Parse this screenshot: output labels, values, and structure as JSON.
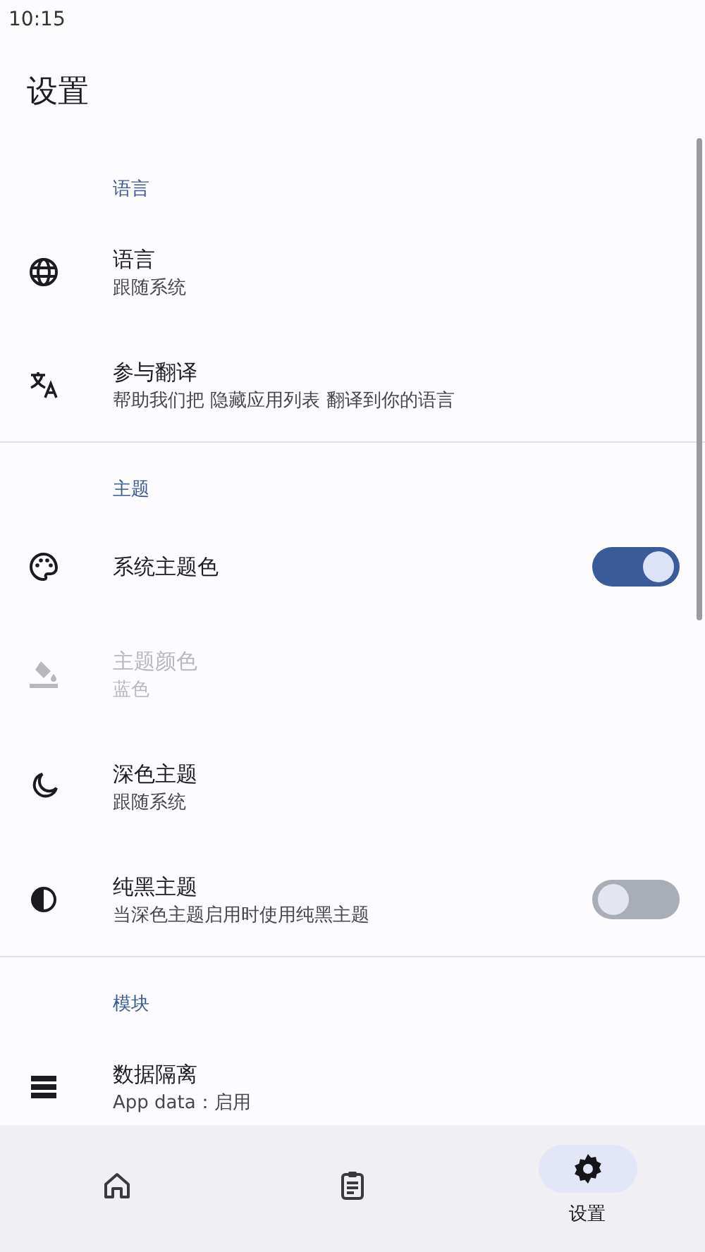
{
  "status_bar": {
    "time": "10:15"
  },
  "title": "设置",
  "sections": [
    {
      "header": "语言",
      "items": [
        {
          "kind": "plain",
          "title": "语言",
          "subtitle": "跟随系统",
          "disabled": false
        },
        {
          "kind": "plain",
          "title": "参与翻译",
          "subtitle": "帮助我们把 隐藏应用列表 翻译到你的语言",
          "disabled": false
        }
      ]
    },
    {
      "header": "主题",
      "items": [
        {
          "kind": "toggle",
          "title": "系统主题色",
          "on": true,
          "disabled": false
        },
        {
          "kind": "plain",
          "title": "主题颜色",
          "subtitle": "蓝色",
          "disabled": true
        },
        {
          "kind": "plain",
          "title": "深色主题",
          "subtitle": "跟随系统",
          "disabled": false
        },
        {
          "kind": "toggle",
          "title": "纯黑主题",
          "subtitle": "当深色主题启用时使用纯黑主题",
          "on": false,
          "disabled": false
        }
      ]
    },
    {
      "header": "模块",
      "items": [
        {
          "kind": "plain",
          "title": "数据隔离",
          "subtitle": "App data：启用",
          "disabled": false
        }
      ]
    }
  ],
  "nav": [
    {
      "selected": false
    },
    {
      "selected": false
    },
    {
      "label": "设置",
      "selected": true
    }
  ]
}
